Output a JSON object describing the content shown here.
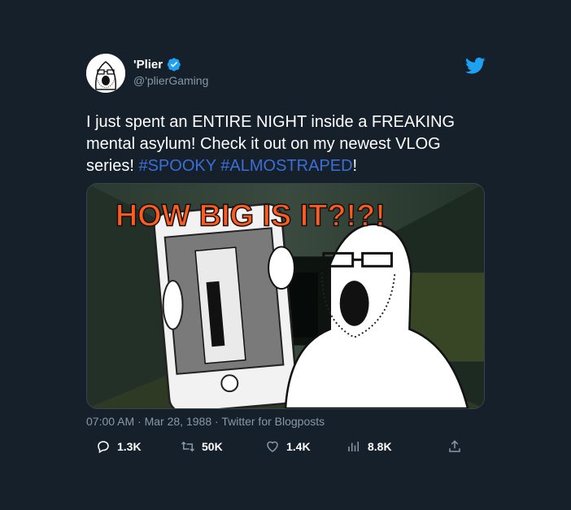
{
  "author": {
    "display_name": "'Plier",
    "handle": "@'plierGaming",
    "verified": true
  },
  "tweet": {
    "text_before": "I just spent an ENTIRE NIGHT inside a FREAKING mental asylum! Check it out on my newest VLOG series! ",
    "hashtags": [
      "#SPOOKY",
      "#ALMOSTRAPED"
    ],
    "text_after": "!"
  },
  "media": {
    "overlay_text": "HOW BIG IS IT?!?!"
  },
  "meta": {
    "time": "07:00 AM",
    "separator": "·",
    "date": "Mar 28, 1988",
    "source": "Twitter for Blogposts"
  },
  "actions": {
    "replies": "1.3K",
    "retweets": "50K",
    "likes": "1.4K",
    "views": "8.8K"
  },
  "colors": {
    "background": "#15202b",
    "accent": "#1da1f2",
    "hashtag": "#3b6ed6",
    "secondary_text": "#8899a6",
    "overlay_text": "#ff5a1f"
  },
  "icons": [
    "verified-badge-icon",
    "twitter-bird-icon",
    "reply-icon",
    "retweet-icon",
    "like-icon",
    "views-icon",
    "share-icon"
  ]
}
